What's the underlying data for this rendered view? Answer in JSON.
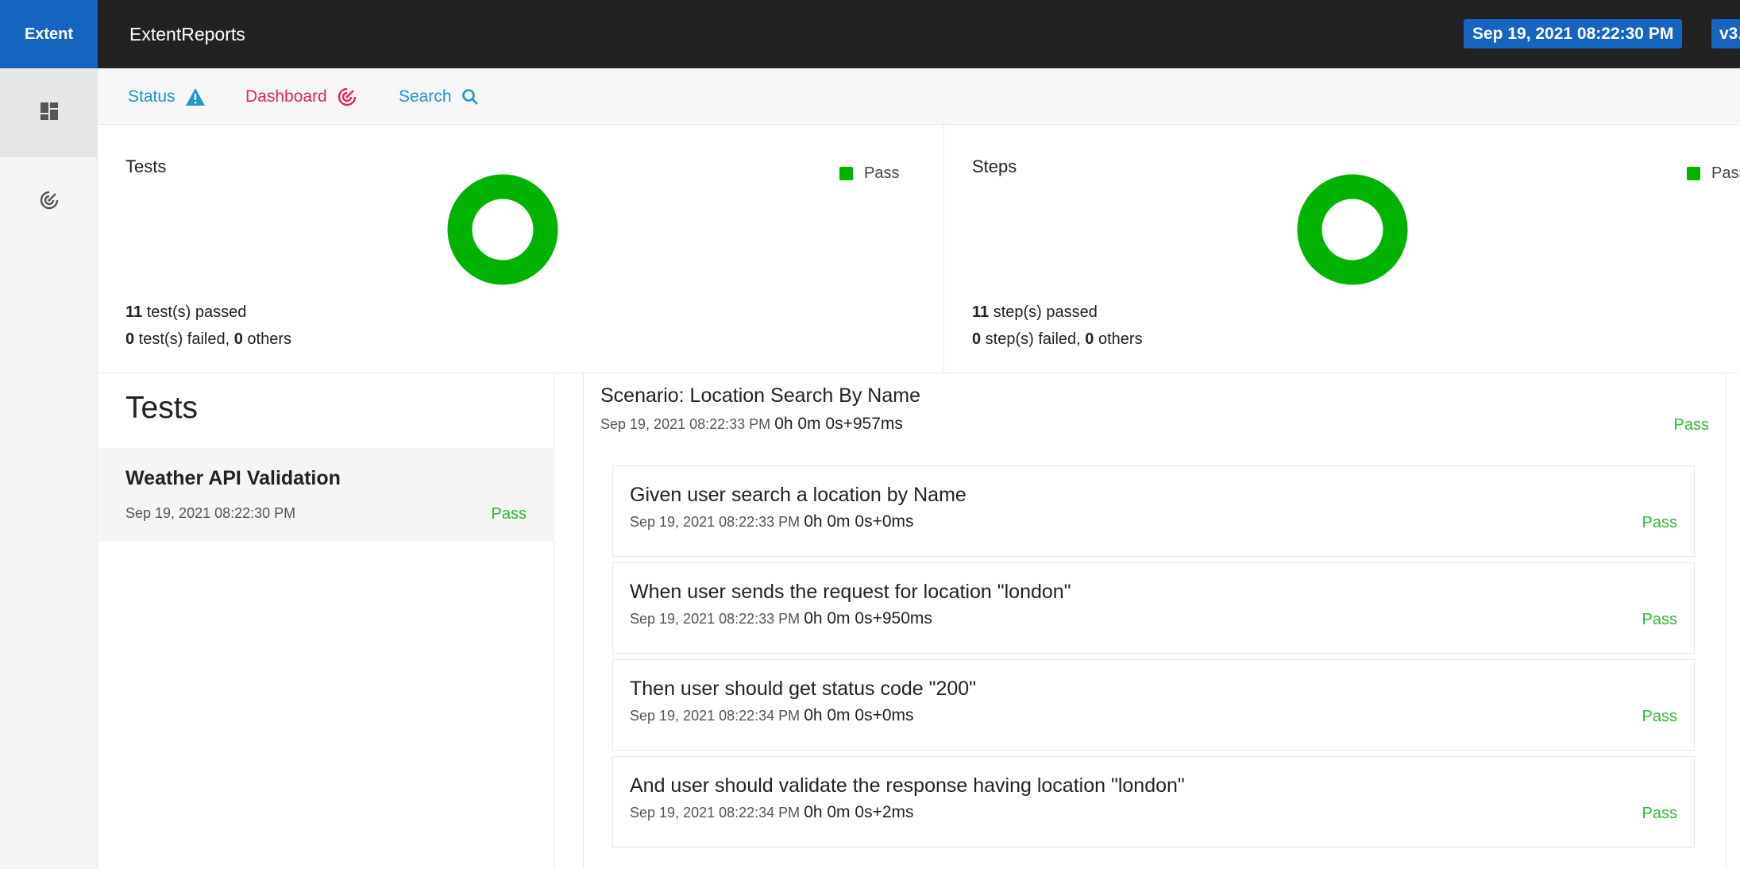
{
  "header": {
    "logo": "Extent",
    "brand": "ExtentReports",
    "date_badge": "Sep 19, 2021 08:22:30 PM",
    "version_badge": "v3."
  },
  "sidenav": {
    "items": [
      {
        "icon": "dashboard-grid-icon",
        "active": true
      },
      {
        "icon": "target-icon",
        "active": false
      }
    ]
  },
  "subnav": {
    "status": {
      "label": "Status",
      "icon": "warning-icon",
      "color": "#2196c8"
    },
    "dashboard": {
      "label": "Dashboard",
      "icon": "target-icon",
      "color": "#e0245e"
    },
    "search": {
      "label": "Search",
      "icon": "search-icon",
      "color": "#2196c8"
    }
  },
  "stats": {
    "tests": {
      "title": "Tests",
      "legend": "Pass",
      "passed_count": "11",
      "passed_text": " test(s) passed",
      "failed_count": "0",
      "failed_text": " test(s) failed, ",
      "others_count": "0",
      "others_text": " others"
    },
    "steps": {
      "title": "Steps",
      "legend": "Pass",
      "passed_count": "11",
      "passed_text": " step(s) passed",
      "failed_count": "0",
      "failed_text": " step(s) failed, ",
      "others_count": "0",
      "others_text": " others"
    },
    "pass_color": "#00b300"
  },
  "chart_data": [
    {
      "type": "pie",
      "title": "Tests",
      "categories": [
        "Pass"
      ],
      "values": [
        11
      ]
    },
    {
      "type": "pie",
      "title": "Steps",
      "categories": [
        "Pass"
      ],
      "values": [
        11
      ]
    }
  ],
  "test_list": {
    "heading": "Tests",
    "items": [
      {
        "name": "Weather API Validation",
        "time": "Sep 19, 2021 08:22:30 PM",
        "status": "Pass"
      }
    ]
  },
  "scenario": {
    "title": "Scenario: Location Search By Name",
    "time": "Sep 19, 2021 08:22:33 PM",
    "duration": "0h 0m 0s+957ms",
    "status": "Pass",
    "steps": [
      {
        "text": "Given user search a location by Name",
        "time": "Sep 19, 2021 08:22:33 PM",
        "duration": "0h 0m 0s+0ms",
        "status": "Pass"
      },
      {
        "text": "When user sends the request for location \"london\"",
        "time": "Sep 19, 2021 08:22:33 PM",
        "duration": "0h 0m 0s+950ms",
        "status": "Pass"
      },
      {
        "text": "Then user should get status code \"200\"",
        "time": "Sep 19, 2021 08:22:34 PM",
        "duration": "0h 0m 0s+0ms",
        "status": "Pass"
      },
      {
        "text": "And user should validate the response having location \"london\"",
        "time": "Sep 19, 2021 08:22:34 PM",
        "duration": "0h 0m 0s+2ms",
        "status": "Pass"
      }
    ]
  }
}
